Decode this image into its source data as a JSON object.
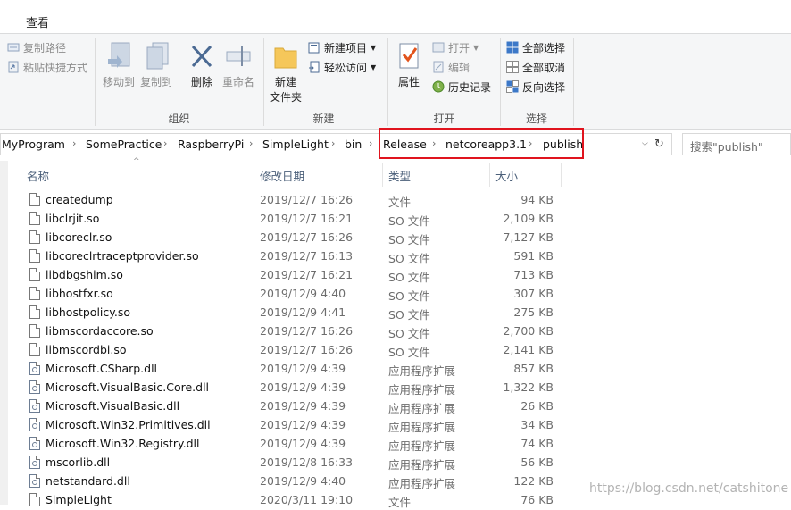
{
  "tabs": {
    "view_label": "查看"
  },
  "ribbon": {
    "clipboard": {
      "copy_path": "复制路径",
      "paste_shortcut": "粘贴快捷方式"
    },
    "organize": {
      "move_to": "移动到",
      "copy_to": "复制到",
      "delete": "删除",
      "rename": "重命名",
      "label": "组织"
    },
    "new": {
      "new_folder_line1": "新建",
      "new_folder_line2": "文件夹",
      "new_item": "新建项目",
      "easy_access": "轻松访问",
      "label": "新建"
    },
    "open": {
      "properties": "属性",
      "open": "打开",
      "edit": "编辑",
      "history": "历史记录",
      "label": "打开"
    },
    "select": {
      "select_all": "全部选择",
      "select_none": "全部取消",
      "invert": "反向选择",
      "label": "选择"
    }
  },
  "address": {
    "crumbs": [
      "MyProgram",
      "SomePractice",
      "RaspberryPi",
      "SimpleLight",
      "bin",
      "Release",
      "netcoreapp3.1",
      "publish"
    ],
    "separator": "›",
    "refresh_icon": "↻",
    "dropdown_icon": "⌵"
  },
  "search": {
    "placeholder": "搜索\"publish\""
  },
  "columns": {
    "name": "名称",
    "date": "修改日期",
    "type": "类型",
    "size": "大小",
    "sort_indicator": "^"
  },
  "files": [
    {
      "name": "createdump",
      "date": "2019/12/7 16:26",
      "type": "文件",
      "size": "94 KB",
      "icon": "file"
    },
    {
      "name": "libclrjit.so",
      "date": "2019/12/7 16:21",
      "type": "SO 文件",
      "size": "2,109 KB",
      "icon": "file"
    },
    {
      "name": "libcoreclr.so",
      "date": "2019/12/7 16:26",
      "type": "SO 文件",
      "size": "7,127 KB",
      "icon": "file"
    },
    {
      "name": "libcoreclrtraceptprovider.so",
      "date": "2019/12/7 16:13",
      "type": "SO 文件",
      "size": "591 KB",
      "icon": "file"
    },
    {
      "name": "libdbgshim.so",
      "date": "2019/12/7 16:21",
      "type": "SO 文件",
      "size": "713 KB",
      "icon": "file"
    },
    {
      "name": "libhostfxr.so",
      "date": "2019/12/9 4:40",
      "type": "SO 文件",
      "size": "307 KB",
      "icon": "file"
    },
    {
      "name": "libhostpolicy.so",
      "date": "2019/12/9 4:41",
      "type": "SO 文件",
      "size": "275 KB",
      "icon": "file"
    },
    {
      "name": "libmscordaccore.so",
      "date": "2019/12/7 16:26",
      "type": "SO 文件",
      "size": "2,700 KB",
      "icon": "file"
    },
    {
      "name": "libmscordbi.so",
      "date": "2019/12/7 16:26",
      "type": "SO 文件",
      "size": "2,141 KB",
      "icon": "file"
    },
    {
      "name": "Microsoft.CSharp.dll",
      "date": "2019/12/9 4:39",
      "type": "应用程序扩展",
      "size": "857 KB",
      "icon": "dll"
    },
    {
      "name": "Microsoft.VisualBasic.Core.dll",
      "date": "2019/12/9 4:39",
      "type": "应用程序扩展",
      "size": "1,322 KB",
      "icon": "dll"
    },
    {
      "name": "Microsoft.VisualBasic.dll",
      "date": "2019/12/9 4:39",
      "type": "应用程序扩展",
      "size": "26 KB",
      "icon": "dll"
    },
    {
      "name": "Microsoft.Win32.Primitives.dll",
      "date": "2019/12/9 4:39",
      "type": "应用程序扩展",
      "size": "34 KB",
      "icon": "dll"
    },
    {
      "name": "Microsoft.Win32.Registry.dll",
      "date": "2019/12/9 4:39",
      "type": "应用程序扩展",
      "size": "74 KB",
      "icon": "dll"
    },
    {
      "name": "mscorlib.dll",
      "date": "2019/12/8 16:33",
      "type": "应用程序扩展",
      "size": "56 KB",
      "icon": "dll"
    },
    {
      "name": "netstandard.dll",
      "date": "2019/12/9 4:40",
      "type": "应用程序扩展",
      "size": "122 KB",
      "icon": "dll"
    },
    {
      "name": "SimpleLight",
      "date": "2020/3/11 19:10",
      "type": "文件",
      "size": "76 KB",
      "icon": "file"
    }
  ],
  "watermark": "https://blog.csdn.net/catshitone",
  "colors": {
    "highlight": "#e0141e",
    "header_text": "#4c607a",
    "ribbon_bg": "#f5f6f7"
  }
}
